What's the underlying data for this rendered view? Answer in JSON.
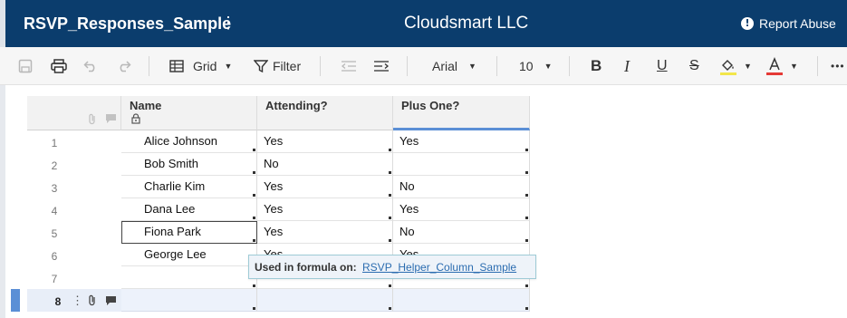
{
  "header": {
    "sheet_title": "RSVP_Responses_Sample",
    "menu_glyph": "⋮",
    "company": "Cloudsmart LLC",
    "report_label": "Report Abuse"
  },
  "toolbar": {
    "grid_label": "Grid",
    "filter_label": "Filter",
    "font_name": "Arial",
    "font_size": "10",
    "more_glyph": "•••"
  },
  "columns": [
    {
      "label": "Name",
      "locked": true
    },
    {
      "label": "Attending?"
    },
    {
      "label": "Plus One?"
    }
  ],
  "rows": [
    {
      "num": "1",
      "name": "Alice Johnson",
      "attending": "Yes",
      "plus_one": "Yes"
    },
    {
      "num": "2",
      "name": "Bob Smith",
      "attending": "No",
      "plus_one": ""
    },
    {
      "num": "3",
      "name": "Charlie Kim",
      "attending": "Yes",
      "plus_one": "No"
    },
    {
      "num": "4",
      "name": "Dana Lee",
      "attending": "Yes",
      "plus_one": "Yes"
    },
    {
      "num": "5",
      "name": "Fiona Park",
      "attending": "Yes",
      "plus_one": "No"
    },
    {
      "num": "6",
      "name": "George Lee",
      "attending": "Yes",
      "plus_one": "Yes"
    },
    {
      "num": "7",
      "name": "",
      "attending": "",
      "plus_one": ""
    },
    {
      "num": "8",
      "name": "",
      "attending": "",
      "plus_one": ""
    }
  ],
  "tooltip": {
    "label": "Used in formula on:",
    "link": "RSVP_Helper_Column_Sample"
  },
  "colors": {
    "header_bg": "#0b3d6d",
    "selection_accent": "#5b8fd6",
    "highlight_yellow": "#f2e64a",
    "text_color_red": "#e53935"
  }
}
